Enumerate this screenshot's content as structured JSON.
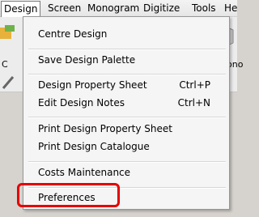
{
  "menubar": {
    "items": [
      {
        "label": "Design"
      },
      {
        "label": "Screen"
      },
      {
        "label": "Monogram"
      },
      {
        "label": "Digitize"
      },
      {
        "label": "Tools"
      },
      {
        "label": "He"
      }
    ]
  },
  "toolbar": {
    "left_label": "C",
    "right_label": "ono"
  },
  "design_menu": {
    "items": [
      {
        "label": "Centre Design",
        "shortcut": ""
      },
      {
        "label": "Save Design Palette",
        "shortcut": ""
      },
      {
        "label": "Design Property Sheet",
        "shortcut": "Ctrl+P"
      },
      {
        "label": "Edit Design Notes",
        "shortcut": "Ctrl+N"
      },
      {
        "label": "Print Design Property Sheet",
        "shortcut": ""
      },
      {
        "label": "Print Design Catalogue",
        "shortcut": ""
      },
      {
        "label": "Costs Maintenance",
        "shortcut": ""
      },
      {
        "label": "Preferences",
        "shortcut": ""
      }
    ]
  },
  "colors": {
    "highlight_annotation": "#e60000",
    "menu_background": "#f5f5f5"
  }
}
